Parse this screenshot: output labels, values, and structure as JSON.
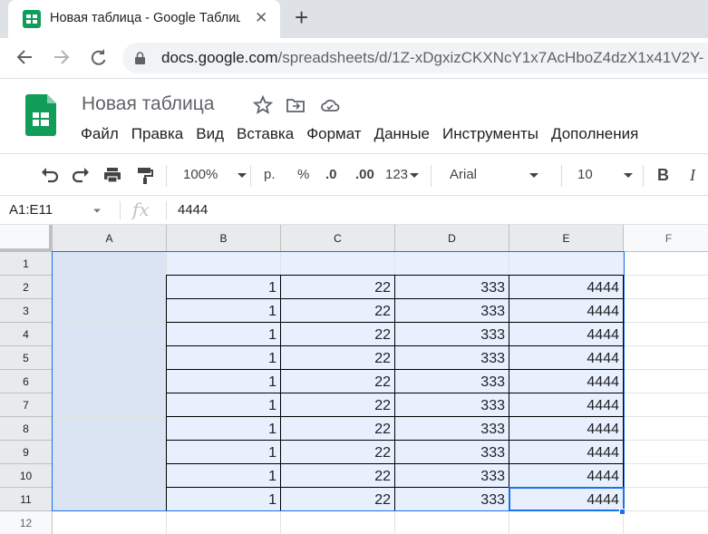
{
  "browser": {
    "tab_title": "Новая таблица - Google Таблицы",
    "url_host": "docs.google.com",
    "url_path": "/spreadsheets/d/1Z-xDgxizCKXNcY1x7AcHboZ4dzX1x41V2Y-"
  },
  "doc": {
    "title": "Новая таблица",
    "menu": [
      "Файл",
      "Правка",
      "Вид",
      "Вставка",
      "Формат",
      "Данные",
      "Инструменты",
      "Дополнения"
    ]
  },
  "toolbar": {
    "zoom": "100%",
    "currency": "р.",
    "percent": "%",
    "dec_less": ".0",
    "dec_more": ".00",
    "more_formats": "123",
    "font": "Arial",
    "font_size": "10",
    "bold": "B",
    "italic": "I"
  },
  "formula_bar": {
    "name_box": "A1:E11",
    "fx": "fx",
    "value": "4444"
  },
  "sheet": {
    "columns": [
      "A",
      "B",
      "C",
      "D",
      "E",
      "F"
    ],
    "rows": [
      "1",
      "2",
      "3",
      "4",
      "5",
      "6",
      "7",
      "8",
      "9",
      "10",
      "11",
      "12"
    ],
    "data": [
      [
        "",
        "",
        "",
        "",
        "",
        ""
      ],
      [
        "",
        "1",
        "22",
        "333",
        "4444",
        ""
      ],
      [
        "",
        "1",
        "22",
        "333",
        "4444",
        ""
      ],
      [
        "",
        "1",
        "22",
        "333",
        "4444",
        ""
      ],
      [
        "",
        "1",
        "22",
        "333",
        "4444",
        ""
      ],
      [
        "",
        "1",
        "22",
        "333",
        "4444",
        ""
      ],
      [
        "",
        "1",
        "22",
        "333",
        "4444",
        ""
      ],
      [
        "",
        "1",
        "22",
        "333",
        "4444",
        ""
      ],
      [
        "",
        "1",
        "22",
        "333",
        "4444",
        ""
      ],
      [
        "",
        "1",
        "22",
        "333",
        "4444",
        ""
      ],
      [
        "",
        "1",
        "22",
        "333",
        "4444",
        ""
      ],
      [
        "",
        "",
        "",
        "",
        "",
        ""
      ]
    ]
  },
  "colors": {
    "selection_fill": "#e8f0fe",
    "selection_border": "#1a73e8",
    "sheets_green": "#0f9d58"
  }
}
